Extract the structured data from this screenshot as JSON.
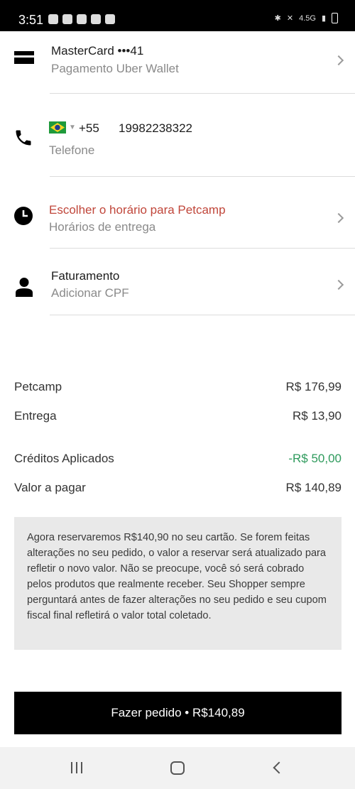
{
  "status_bar": {
    "time": "3:51",
    "network": "4.5G"
  },
  "payment": {
    "title": "MasterCard •••41",
    "subtitle": "Pagamento Uber Wallet"
  },
  "phone": {
    "country_code": "+55",
    "number": "19982238322",
    "label": "Telefone"
  },
  "delivery_time": {
    "title": "Escolher o horário para Petcamp",
    "subtitle": "Horários de entrega",
    "title_color": "#c0463a"
  },
  "billing": {
    "title": "Faturamento",
    "subtitle": "Adicionar CPF"
  },
  "summary": [
    {
      "label": "Petcamp",
      "value": "R$ 176,99"
    },
    {
      "label": "Entrega",
      "value": "R$ 13,90"
    },
    {
      "label": "Créditos Aplicados",
      "value": "-R$ 50,00"
    },
    {
      "label": "Valor a pagar",
      "value": "R$ 140,89"
    }
  ],
  "notice": "Agora reservaremos R$140,90 no seu cartão. Se forem feitas alterações no seu pedido, o valor a reservar será atualizado para refletir o novo valor. Não se preocupe, você só será cobrado pelos produtos que realmente receber. Seu Shopper sempre perguntará antes de fazer alterações no seu pedido e seu cupom fiscal final refletirá o valor total coletado.",
  "cta": {
    "label": "Fazer pedido • R$140,89"
  },
  "colors": {
    "accent_red": "#c0463a",
    "credit_green": "#2e9a5c",
    "button_bg": "#000000"
  },
  "icons": [
    "card-icon",
    "phone-icon",
    "clock-icon",
    "person-icon",
    "chevron-right-icon",
    "brazil-flag-icon"
  ]
}
